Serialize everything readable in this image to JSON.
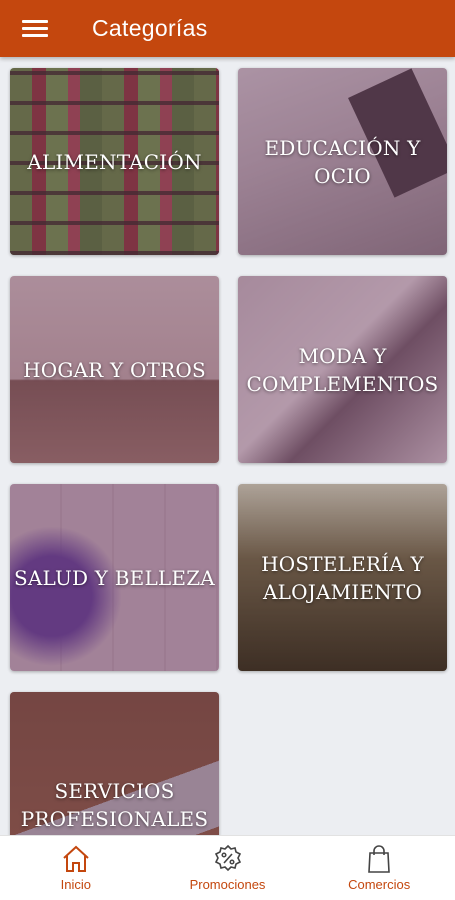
{
  "appbar": {
    "title": "Categorías",
    "menu_icon": "hamburger-menu-icon"
  },
  "categories": [
    {
      "label": "ALIMENTACIÓN"
    },
    {
      "label": "EDUCACIÓN Y OCIO"
    },
    {
      "label": "HOGAR Y OTROS"
    },
    {
      "label": "MODA Y COMPLEMENTOS"
    },
    {
      "label": "SALUD Y BELLEZA"
    },
    {
      "label": "HOSTELERÍA Y ALOJAMIENTO"
    },
    {
      "label": "SERVICIOS PROFESIONALES"
    }
  ],
  "bottom_nav": {
    "items": [
      {
        "label": "Inicio",
        "icon": "home-icon"
      },
      {
        "label": "Promociones",
        "icon": "discount-badge-icon"
      },
      {
        "label": "Comercios",
        "icon": "shopping-bag-icon"
      }
    ]
  },
  "colors": {
    "primary": "#c4470e",
    "background": "#eceef2"
  }
}
